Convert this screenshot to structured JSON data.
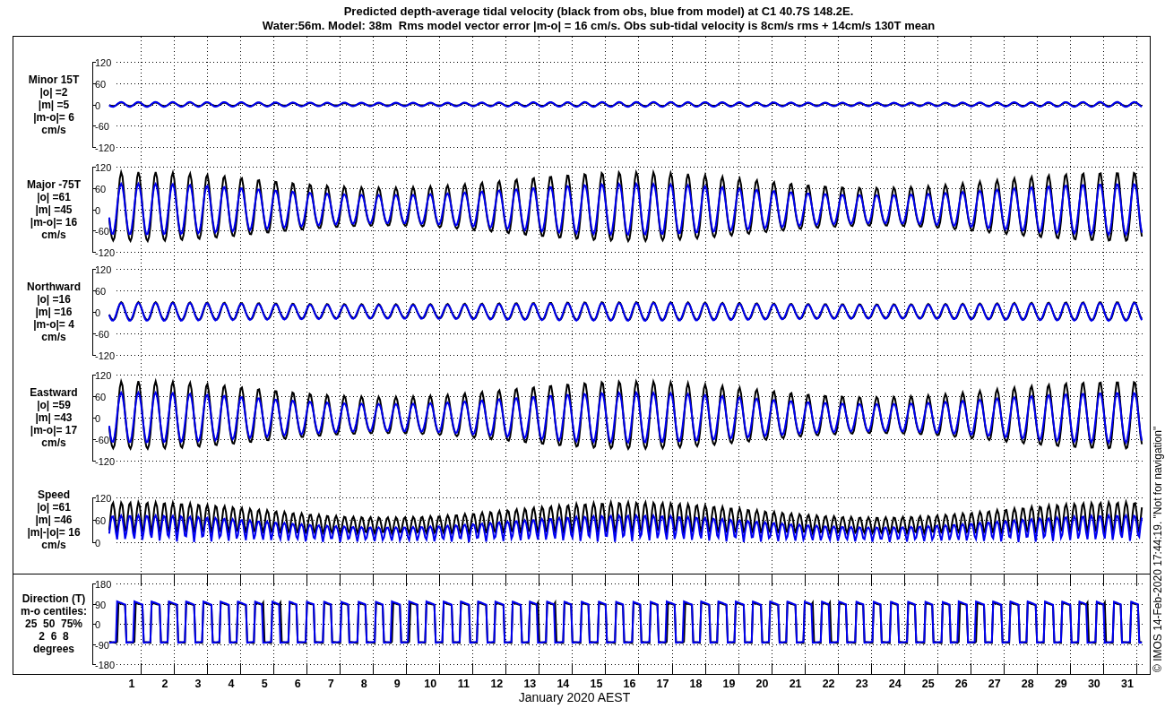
{
  "title": [
    "Predicted depth-average tidal velocity (black from obs, blue from model) at C1 40.7S 148.2E.",
    "Water:56m. Model: 38m  Rms model vector error |m-o| = 16 cm/s. Obs sub-tidal velocity is 8cm/s rms + 14cm/s 130T mean"
  ],
  "panels": [
    {
      "kind": "velocity",
      "label": [
        "Minor 15T",
        "|o| =2",
        "|m| =5",
        "|m-o|= 6",
        "cm/s"
      ],
      "yticks": [
        "120",
        "60",
        "0",
        "-60",
        "-120"
      ]
    },
    {
      "kind": "velocity",
      "label": [
        "Major -75T",
        "|o| =61",
        "|m| =45",
        "|m-o|= 16",
        "cm/s"
      ],
      "yticks": [
        "120",
        "60",
        "0",
        "-60",
        "-120"
      ]
    },
    {
      "kind": "velocity",
      "label": [
        "Northward",
        "|o| =16",
        "|m| =16",
        "|m-o|= 4",
        "cm/s"
      ],
      "yticks": [
        "120",
        "60",
        "0",
        "-60",
        "-120"
      ]
    },
    {
      "kind": "velocity",
      "label": [
        "Eastward",
        "|o| =59",
        "|m| =43",
        "|m-o|= 17",
        "cm/s"
      ],
      "yticks": [
        "120",
        "60",
        "0",
        "-60",
        "-120"
      ]
    },
    {
      "kind": "speed",
      "label": [
        "Speed",
        "|o| =61",
        "|m| =46",
        "|m|-|o|= 16",
        "cm/s"
      ],
      "yticks": [
        "120",
        "60",
        "0"
      ]
    },
    {
      "kind": "direction",
      "label": [
        "Direction (T)",
        "m-o centiles:",
        "25  50  75%",
        "2  6  8",
        "degrees"
      ],
      "yticks": [
        "180",
        "90",
        "0",
        "-90",
        "-180"
      ]
    }
  ],
  "xticks": [
    "1",
    "2",
    "3",
    "4",
    "5",
    "6",
    "7",
    "8",
    "9",
    "10",
    "11",
    "12",
    "13",
    "14",
    "15",
    "16",
    "17",
    "18",
    "19",
    "20",
    "21",
    "22",
    "23",
    "24",
    "25",
    "26",
    "27",
    "28",
    "29",
    "30",
    "31"
  ],
  "xlabel": "January 2020 AEST",
  "credit": "© IMOS 14-Feb-2020 17:44:19. \"Not for navigation\""
}
